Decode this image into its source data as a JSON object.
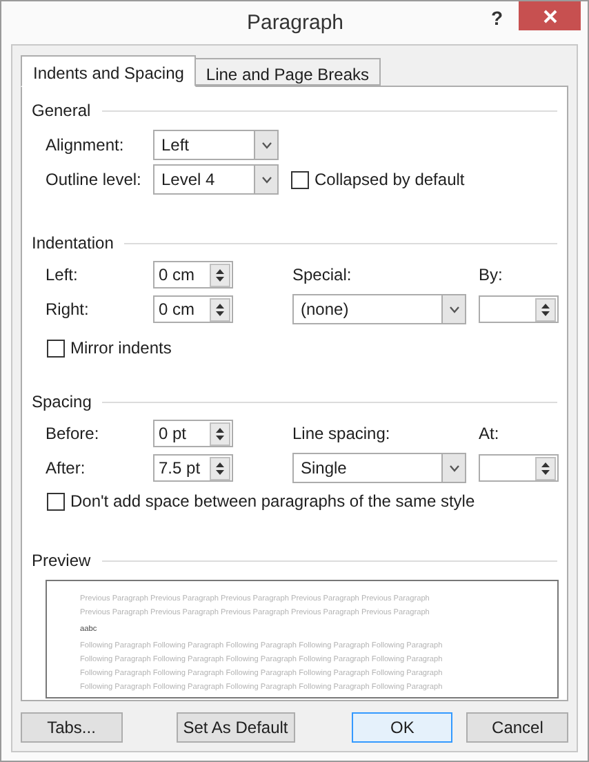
{
  "window": {
    "title": "Paragraph",
    "help": "?"
  },
  "tabs": [
    {
      "label": "Indents and Spacing",
      "selected": true
    },
    {
      "label": "Line and Page Breaks",
      "selected": false
    }
  ],
  "general": {
    "heading": "General",
    "alignment": {
      "label": "Alignment:",
      "value": "Left"
    },
    "outline_level": {
      "label": "Outline level:",
      "value": "Level 4"
    },
    "collapsed": {
      "label": "Collapsed by default",
      "checked": false
    }
  },
  "indentation": {
    "heading": "Indentation",
    "left": {
      "label": "Left:",
      "value": "0 cm"
    },
    "right": {
      "label": "Right:",
      "value": "0 cm"
    },
    "special": {
      "label": "Special:",
      "value": "(none)"
    },
    "by": {
      "label": "By:"
    },
    "mirror_indents": {
      "label": "Mirror indents",
      "checked": false
    }
  },
  "spacing": {
    "heading": "Spacing",
    "before": {
      "label": "Before:",
      "value": "0 pt"
    },
    "after": {
      "label": "After:",
      "value": "7.5 pt"
    },
    "line_spacing": {
      "label": "Line spacing:",
      "value": "Single"
    },
    "at": {
      "label": "At:"
    },
    "dont_add_space": {
      "label": "Don't add space between paragraphs of the same style",
      "checked": false
    }
  },
  "preview": {
    "heading": "Preview",
    "previous_lines": [
      "Previous Paragraph Previous Paragraph Previous Paragraph Previous Paragraph Previous Paragraph",
      "Previous Paragraph Previous Paragraph Previous Paragraph Previous Paragraph Previous Paragraph"
    ],
    "sample": "aabc",
    "following_lines": [
      "Following Paragraph Following Paragraph Following Paragraph Following Paragraph Following Paragraph",
      "Following Paragraph Following Paragraph Following Paragraph Following Paragraph Following Paragraph",
      "Following Paragraph Following Paragraph Following Paragraph Following Paragraph Following Paragraph",
      "Following Paragraph Following Paragraph Following Paragraph Following Paragraph Following Paragraph"
    ]
  },
  "buttons": [
    {
      "label": "Tabs...",
      "default": false
    },
    {
      "label": "Set As Default",
      "default": false
    },
    {
      "label": "OK",
      "default": true
    },
    {
      "label": "Cancel",
      "default": false
    }
  ]
}
